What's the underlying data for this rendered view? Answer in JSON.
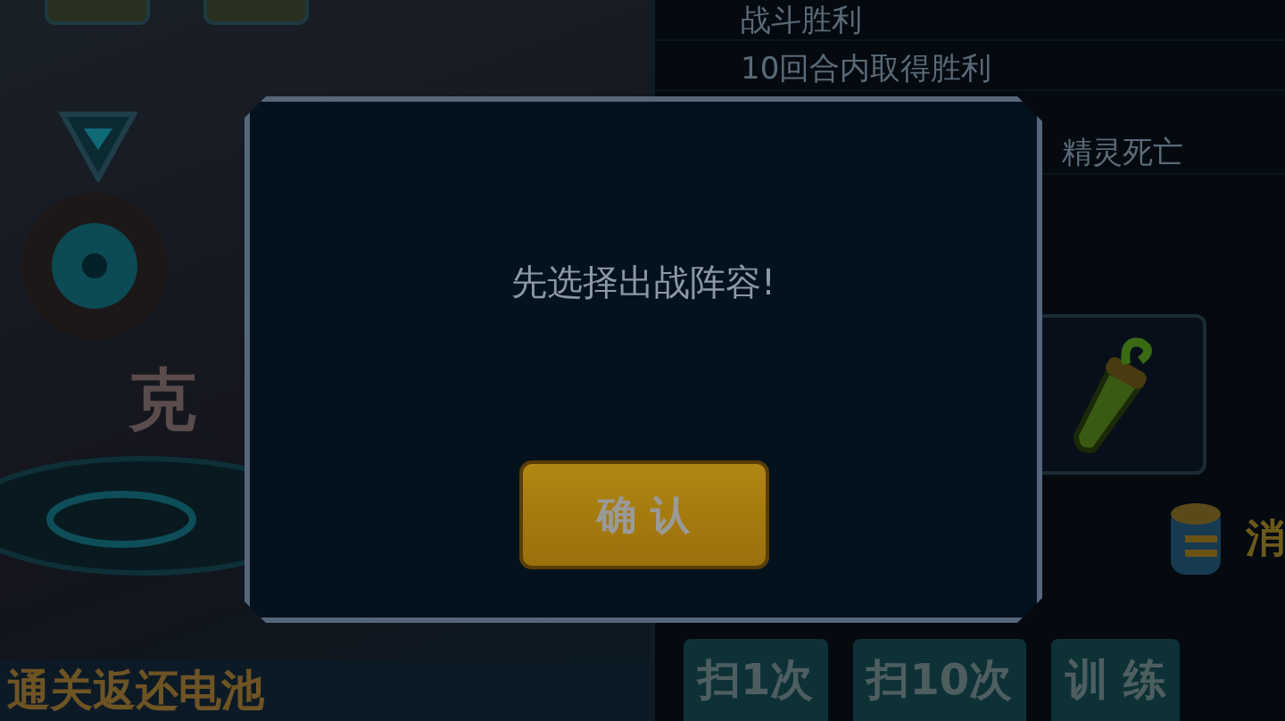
{
  "background": {
    "emblem_title": "克",
    "footer": "通关返还电池",
    "objectives": [
      "战斗胜利",
      "10回合内取得胜利",
      "精灵死亡"
    ],
    "cost_label": "消",
    "actions": [
      "扫1次",
      "扫10次",
      "训 练"
    ]
  },
  "dialog": {
    "message": "先选择出战阵容!",
    "button": "确 认"
  }
}
